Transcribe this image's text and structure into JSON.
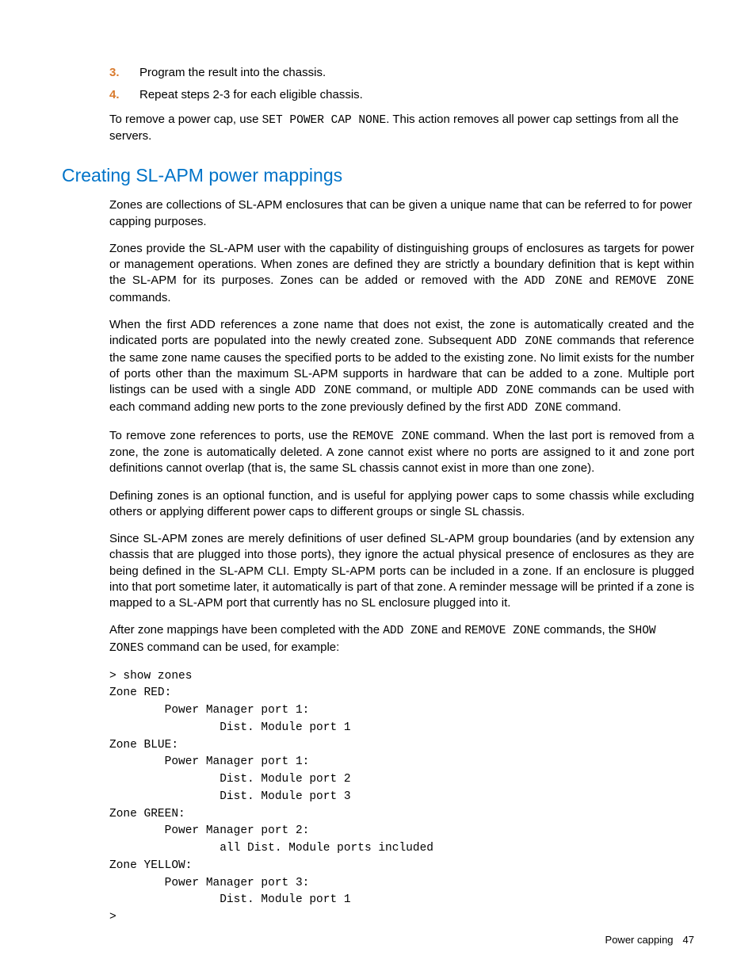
{
  "steps": [
    {
      "num": "3.",
      "text": "Program the result into the chassis."
    },
    {
      "num": "4.",
      "text": "Repeat steps 2-3 for each eligible chassis."
    }
  ],
  "remove_para": {
    "pre": "To remove a power cap, use ",
    "code": "SET POWER CAP NONE",
    "post": ". This action removes all power cap settings from all the servers."
  },
  "heading": "Creating SL-APM power mappings",
  "p1": "Zones are collections of SL-APM enclosures that can be given a unique name that can be referred to for power capping purposes.",
  "p2": {
    "t1": "Zones provide the SL-APM user with the capability of distinguishing groups of enclosures as targets for power or management operations. When zones are defined they are strictly a boundary definition that is kept within the SL-APM for its purposes. Zones can be added or removed with the ",
    "c1": "ADD ZONE",
    "t2": " and ",
    "c2": "REMOVE ZONE",
    "t3": " commands."
  },
  "p3": {
    "t1": "When the first ADD references a zone name that does not exist, the zone is automatically created and the indicated ports are populated into the newly created zone. Subsequent ",
    "c1": "ADD ZONE",
    "t2": " commands that reference the same zone name causes the specified ports to be added to the existing zone. No limit exists for the number of ports other than the maximum SL-APM supports in hardware that can be added to a zone. Multiple port listings can be used with a single ",
    "c2": "ADD ZONE",
    "t3": " command, or multiple ",
    "c3": "ADD ZONE",
    "t4": " commands can be used with each command adding new ports to the zone previously defined by the first ",
    "c4": "ADD ZONE",
    "t5": " command."
  },
  "p4": {
    "t1": "To remove zone references to ports, use the ",
    "c1": "REMOVE ZONE",
    "t2": " command. When the last port is removed from a zone, the zone is automatically deleted. A zone cannot exist where no ports are assigned to it and zone port definitions cannot overlap (that is, the same SL chassis cannot exist in more than one zone)."
  },
  "p5": "Defining zones is an optional function, and is useful for applying power caps to some chassis while excluding others or applying different power caps to different groups or single SL chassis.",
  "p6": "Since SL-APM zones are merely definitions of user defined SL-APM group boundaries (and by extension any chassis that are plugged into those ports), they ignore the actual physical presence of enclosures as they are being defined in the SL-APM CLI. Empty SL-APM ports can be included in a zone. If an enclosure is plugged into that port sometime later, it automatically is part of that zone. A reminder message will be printed if a zone is mapped to a SL-APM port that currently has no SL enclosure plugged into it.",
  "p7": {
    "t1": "After zone mappings have been completed with the ",
    "c1": "ADD ZONE",
    "t2": " and ",
    "c2": "REMOVE ZONE",
    "t3": " commands, the ",
    "c3": "SHOW ZONES",
    "t4": " command can be used, for example:"
  },
  "code": "> show zones\nZone RED:\n        Power Manager port 1:\n                Dist. Module port 1\nZone BLUE:\n        Power Manager port 1:\n                Dist. Module port 2\n                Dist. Module port 3\nZone GREEN:\n        Power Manager port 2:\n                all Dist. Module ports included\nZone YELLOW:\n        Power Manager port 3:\n                Dist. Module port 1\n>",
  "footer": {
    "section": "Power capping",
    "page": "47"
  }
}
